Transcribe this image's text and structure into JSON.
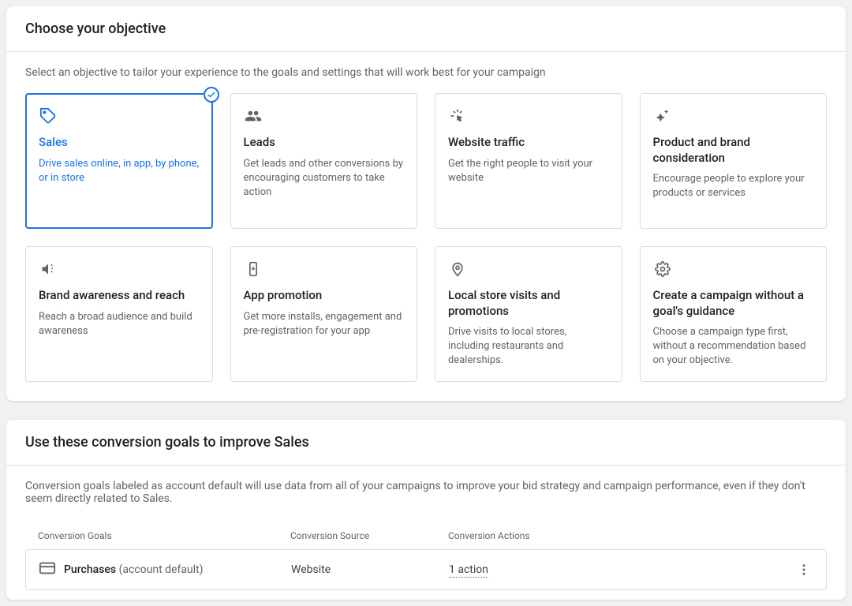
{
  "objective_section": {
    "title": "Choose your objective",
    "subtitle": "Select an objective to tailor your experience to the goals and settings that will work best for your campaign",
    "cards": [
      {
        "title": "Sales",
        "desc": "Drive sales online, in app, by phone, or in store",
        "selected": true
      },
      {
        "title": "Leads",
        "desc": "Get leads and other conversions by encouraging customers to take action",
        "selected": false
      },
      {
        "title": "Website traffic",
        "desc": "Get the right people to visit your website",
        "selected": false
      },
      {
        "title": "Product and brand consideration",
        "desc": "Encourage people to explore your products or services",
        "selected": false
      },
      {
        "title": "Brand awareness and reach",
        "desc": "Reach a broad audience and build awareness",
        "selected": false
      },
      {
        "title": "App promotion",
        "desc": "Get more installs, engagement and pre-registration for your app",
        "selected": false
      },
      {
        "title": "Local store visits and promotions",
        "desc": "Drive visits to local stores, including restaurants and dealerships.",
        "selected": false
      },
      {
        "title": "Create a campaign without a goal's guidance",
        "desc": "Choose a campaign type first, without a recommendation based on your objective.",
        "selected": false
      }
    ]
  },
  "goals_section": {
    "title": "Use these conversion goals to improve Sales",
    "subtitle": "Conversion goals labeled as account default will use data from all of your campaigns to improve your bid strategy and campaign performance, even if they don't seem directly related to Sales.",
    "columns": {
      "c1": "Conversion Goals",
      "c2": "Conversion Source",
      "c3": "Conversion Actions"
    },
    "row": {
      "name": "Purchases",
      "suffix": "(account default)",
      "source": "Website",
      "actions": "1 action"
    }
  }
}
